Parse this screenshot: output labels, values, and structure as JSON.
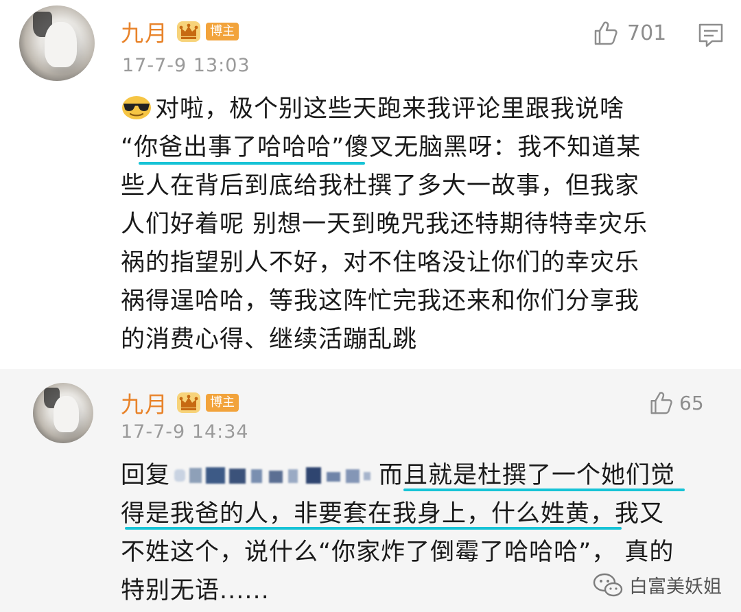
{
  "colors": {
    "username": "#e8832a",
    "badge": "#f2a33b",
    "underline": "#17c3d6",
    "timestamp": "#9a9a9a",
    "secondary_background": "#f5f5f5"
  },
  "comments": [
    {
      "username": "九月",
      "badge": "博主",
      "timestamp": "17-7-9 13:03",
      "likes": "701",
      "icons": [
        "avatar",
        "crown-icon",
        "thumbs-up-icon",
        "comment-icon",
        "sunglasses-emoji"
      ],
      "lines": [
        "对啦，极个别这些天跑来我评论里跟我说啥",
        "“你爸出事了哈哈哈”傻叉无脑黑呀：我不知道某",
        "些人在背后到底给我杜撰了多大一故事，但我家",
        "人们好着呢 别想一天到晚咒我还特期待特幸灾乐",
        "祸的指望别人不好，对不住咯没让你们的幸灾乐",
        "祸得逞哈哈，等我这阵忙完我还来和你们分享我",
        "的消费心得、继续活蹦乱跳"
      ]
    },
    {
      "username": "九月",
      "badge": "博主",
      "timestamp": "17-7-9 14:34",
      "likes": "65",
      "icons": [
        "avatar",
        "crown-icon",
        "thumbs-up-icon"
      ],
      "reply_prefix": "回复",
      "lines_after_mention": "而且就是杜撰了一个她们觉",
      "lines": [
        "得是我爸的人，非要套在我身上，什么姓黄，我又",
        "不姓这个，说什么“你家炸了倒霉了哈哈哈”， 真的",
        "特别无语......"
      ]
    }
  ],
  "watermark": {
    "text": "白富美妖姐",
    "icon": "wechat-icon"
  }
}
